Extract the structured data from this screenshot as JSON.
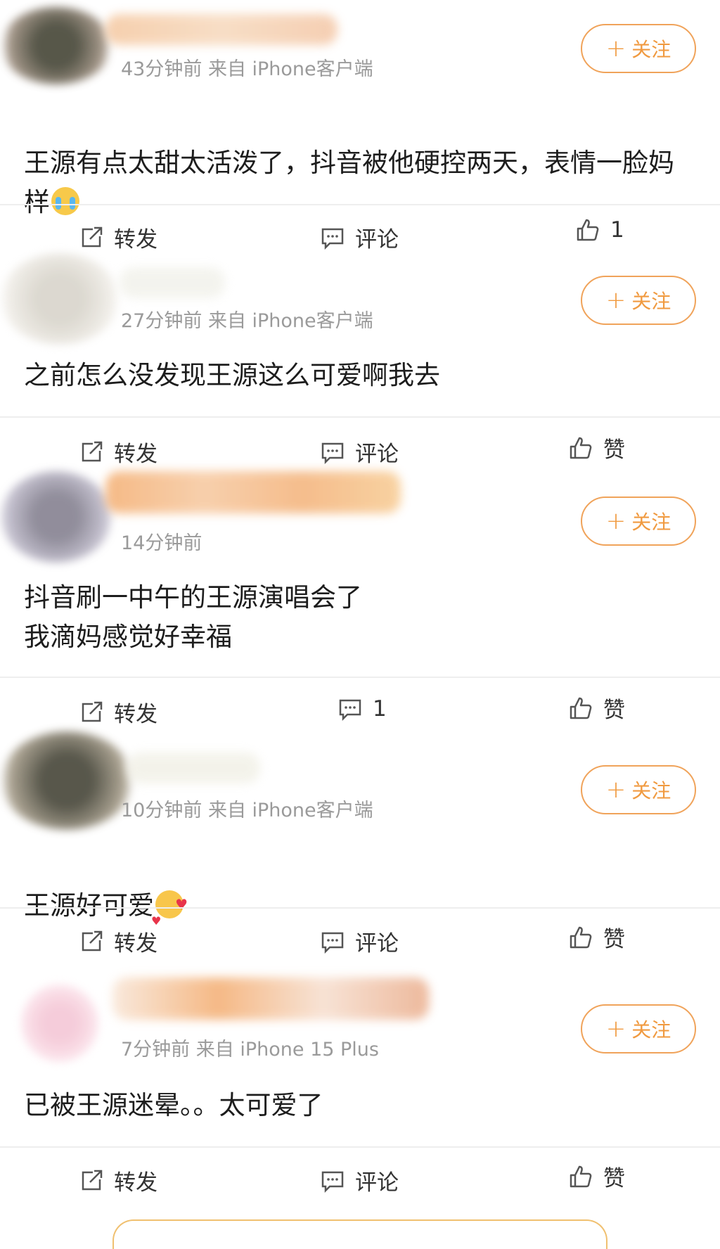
{
  "posts": [
    {
      "meta": "43分钟前  来自 iPhone客户端",
      "follow_label": "关注",
      "content": "王源有点太甜太活泼了，抖音被他硬控两天，表情一脸妈样",
      "emoji": "crying-face-icon",
      "actions": {
        "repost": "转发",
        "comment": "评论",
        "like": "1"
      }
    },
    {
      "meta": "27分钟前  来自 iPhone客户端",
      "follow_label": "关注",
      "content": "之前怎么没发现王源这么可爱啊我去",
      "actions": {
        "repost": "转发",
        "comment": "评论",
        "like": "赞"
      }
    },
    {
      "meta": "14分钟前",
      "follow_label": "关注",
      "content": "抖音刷一中午的王源演唱会了\n我滴妈感觉好幸福",
      "actions": {
        "repost": "转发",
        "comment": "1",
        "like": "赞"
      }
    },
    {
      "meta": "10分钟前  来自 iPhone客户端",
      "follow_label": "关注",
      "content": "王源好可爱",
      "emoji": "smiling-face-with-hearts-icon",
      "actions": {
        "repost": "转发",
        "comment": "评论",
        "like": "赞"
      }
    },
    {
      "meta": "7分钟前  来自 iPhone 15 Plus",
      "follow_label": "关注",
      "content": "已被王源迷晕。。太可爱了",
      "actions": {
        "repost": "转发",
        "comment": "评论",
        "like": "赞"
      }
    }
  ],
  "colors": {
    "accent": "#f09a40",
    "divider": "#eeeeee",
    "meta": "#9a9a9a"
  }
}
